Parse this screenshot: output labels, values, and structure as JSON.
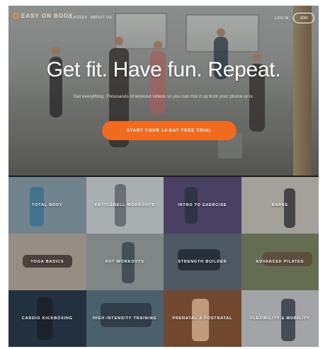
{
  "brand": {
    "name": "EASY ON BODY",
    "accent": "#f06a1f"
  },
  "nav": {
    "links": [
      "CLASSES",
      "ABOUT US"
    ],
    "login": "LOG IN",
    "join": "JOIN"
  },
  "hero": {
    "headline": "Get fit. Have fun. Repeat.",
    "subhead": "Get everything. Thousands of workout videos so you can mix it up from your phone or tv.",
    "cta": "START YOUR 14-DAY FREE TRIAL"
  },
  "categories": [
    {
      "label": "TOTAL BODY",
      "bg": "#8aa0ad"
    },
    {
      "label": "KETTLEBELL WORKOUTS",
      "bg": "#cfd6d8"
    },
    {
      "label": "INTRO TO EXERCISE",
      "bg": "#5a4f7a"
    },
    {
      "label": "BARRE",
      "bg": "#c9c4bc"
    },
    {
      "label": "YOGA BASICS",
      "bg": "#b8aea3"
    },
    {
      "label": "HIIT WORKOUTS",
      "bg": "#9aa5a3"
    },
    {
      "label": "STRENGTH BUILDER",
      "bg": "#5e6c78"
    },
    {
      "label": "ADVANCED PILATES",
      "bg": "#7b8564"
    },
    {
      "label": "CARDIO KICKBOXING",
      "bg": "#2b3b4e"
    },
    {
      "label": "HIGH INTENSITY TRAINING",
      "bg": "#5d7484"
    },
    {
      "label": "PRENATAL & POSTNATAL",
      "bg": "#8a5a3a"
    },
    {
      "label": "FLEXIBILITY & MOBILITY",
      "bg": "#c7c9cc"
    }
  ]
}
